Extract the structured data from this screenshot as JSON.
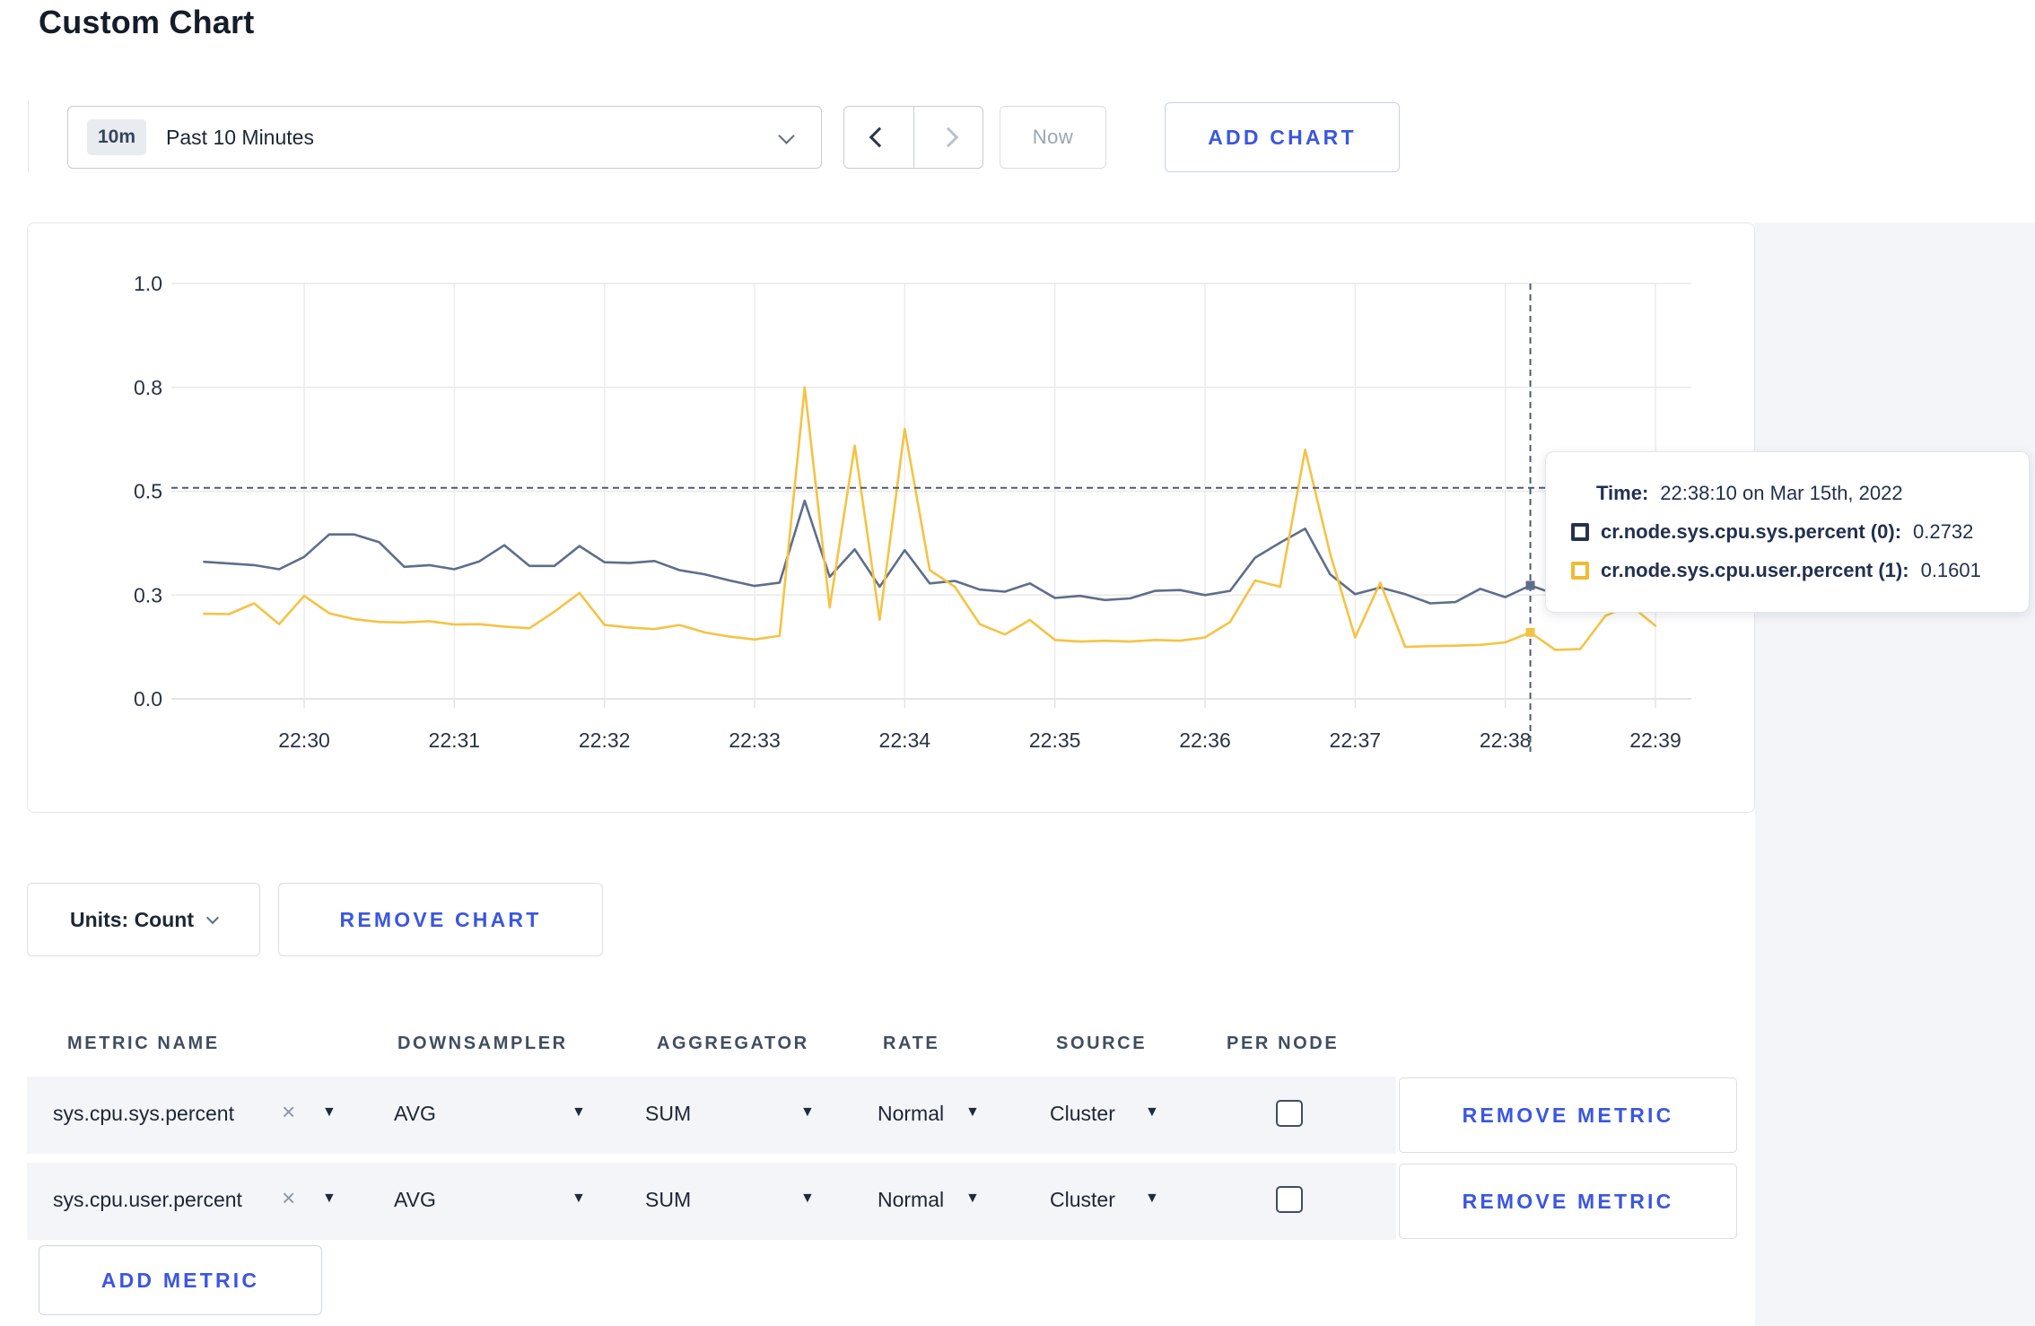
{
  "page": {
    "title": "Custom Chart"
  },
  "toolbar": {
    "time_window_badge": "10m",
    "time_window_label": "Past 10 Minutes",
    "now_label": "Now",
    "add_chart_label": "ADD CHART"
  },
  "icons": {
    "dropdown_caret": "▼",
    "close": "×"
  },
  "tooltip": {
    "time_label": "Time:",
    "time_value": "22:38:10 on Mar 15th, 2022",
    "series": [
      {
        "name": "cr.node.sys.cpu.sys.percent (0):",
        "value": "0.2732",
        "color": "#26324e"
      },
      {
        "name": "cr.node.sys.cpu.user.percent (1):",
        "value": "0.1601",
        "color": "#f0bb33"
      }
    ]
  },
  "chart_controls": {
    "units_label": "Units: Count",
    "remove_chart_label": "REMOVE CHART",
    "add_metric_label": "ADD METRIC"
  },
  "metrics_table": {
    "headers": [
      "METRIC NAME",
      "DOWNSAMPLER",
      "AGGREGATOR",
      "RATE",
      "SOURCE",
      "PER NODE"
    ],
    "rows": [
      {
        "metric": "sys.cpu.sys.percent",
        "downsampler": "AVG",
        "aggregator": "SUM",
        "rate": "Normal",
        "source": "Cluster",
        "per_node_checked": false,
        "remove_label": "REMOVE METRIC"
      },
      {
        "metric": "sys.cpu.user.percent",
        "downsampler": "AVG",
        "aggregator": "SUM",
        "rate": "Normal",
        "source": "Cluster",
        "per_node_checked": false,
        "remove_label": "REMOVE METRIC"
      }
    ]
  },
  "chart_data": {
    "type": "line",
    "title": "",
    "xlabel": "",
    "ylabel": "",
    "ylim": [
      0,
      1
    ],
    "grid": true,
    "y_ticks": [
      0,
      0.25,
      0.5,
      0.75,
      1
    ],
    "y_tick_labels": [
      "0.0",
      "0.3",
      "0.5",
      "0.8",
      "1.0"
    ],
    "x_axis_labels": [
      "22:30",
      "22:31",
      "22:32",
      "22:33",
      "22:34",
      "22:35",
      "22:36",
      "22:37",
      "22:38",
      "22:39"
    ],
    "x_times": [
      "22:29:20",
      "22:29:30",
      "22:29:40",
      "22:29:50",
      "22:30:00",
      "22:30:10",
      "22:30:20",
      "22:30:30",
      "22:30:40",
      "22:30:50",
      "22:31:00",
      "22:31:10",
      "22:31:20",
      "22:31:30",
      "22:31:40",
      "22:31:50",
      "22:32:00",
      "22:32:10",
      "22:32:20",
      "22:32:30",
      "22:32:40",
      "22:32:50",
      "22:33:00",
      "22:33:10",
      "22:33:20",
      "22:33:30",
      "22:33:40",
      "22:33:50",
      "22:34:00",
      "22:34:10",
      "22:34:20",
      "22:34:30",
      "22:34:40",
      "22:34:50",
      "22:35:00",
      "22:35:10",
      "22:35:20",
      "22:35:30",
      "22:35:40",
      "22:35:50",
      "22:36:00",
      "22:36:10",
      "22:36:20",
      "22:36:30",
      "22:36:40",
      "22:36:50",
      "22:37:00",
      "22:37:10",
      "22:37:20",
      "22:37:30",
      "22:37:40",
      "22:37:50",
      "22:38:00",
      "22:38:10",
      "22:38:20",
      "22:38:30",
      "22:38:40",
      "22:38:50",
      "22:39:00"
    ],
    "series": [
      {
        "name": "cr.node.sys.cpu.sys.percent",
        "color": "#5e6e8a",
        "values": [
          0.33,
          0.326,
          0.322,
          0.312,
          0.342,
          0.396,
          0.396,
          0.377,
          0.318,
          0.322,
          0.312,
          0.331,
          0.37,
          0.32,
          0.32,
          0.368,
          0.329,
          0.327,
          0.332,
          0.31,
          0.3,
          0.285,
          0.272,
          0.28,
          0.477,
          0.294,
          0.36,
          0.27,
          0.358,
          0.278,
          0.284,
          0.263,
          0.258,
          0.278,
          0.243,
          0.248,
          0.238,
          0.242,
          0.26,
          0.262,
          0.25,
          0.26,
          0.34,
          0.376,
          0.41,
          0.3,
          0.252,
          0.268,
          0.252,
          0.23,
          0.233,
          0.265,
          0.245,
          0.2732,
          0.252,
          0.262,
          0.27,
          0.268,
          0.28
        ]
      },
      {
        "name": "cr.node.sys.cpu.user.percent",
        "color": "#f5c344",
        "values": [
          0.205,
          0.204,
          0.23,
          0.18,
          0.248,
          0.206,
          0.192,
          0.185,
          0.184,
          0.187,
          0.179,
          0.18,
          0.174,
          0.17,
          0.21,
          0.255,
          0.178,
          0.172,
          0.168,
          0.178,
          0.16,
          0.15,
          0.143,
          0.152,
          0.75,
          0.22,
          0.61,
          0.19,
          0.65,
          0.31,
          0.27,
          0.18,
          0.155,
          0.19,
          0.142,
          0.138,
          0.14,
          0.138,
          0.142,
          0.14,
          0.148,
          0.185,
          0.285,
          0.27,
          0.6,
          0.35,
          0.148,
          0.28,
          0.125,
          0.127,
          0.128,
          0.13,
          0.136,
          0.1601,
          0.118,
          0.12,
          0.2,
          0.225,
          0.176
        ]
      }
    ],
    "crosshair": {
      "index": 53,
      "time": "22:38:10",
      "y_frac": 0.508
    }
  }
}
